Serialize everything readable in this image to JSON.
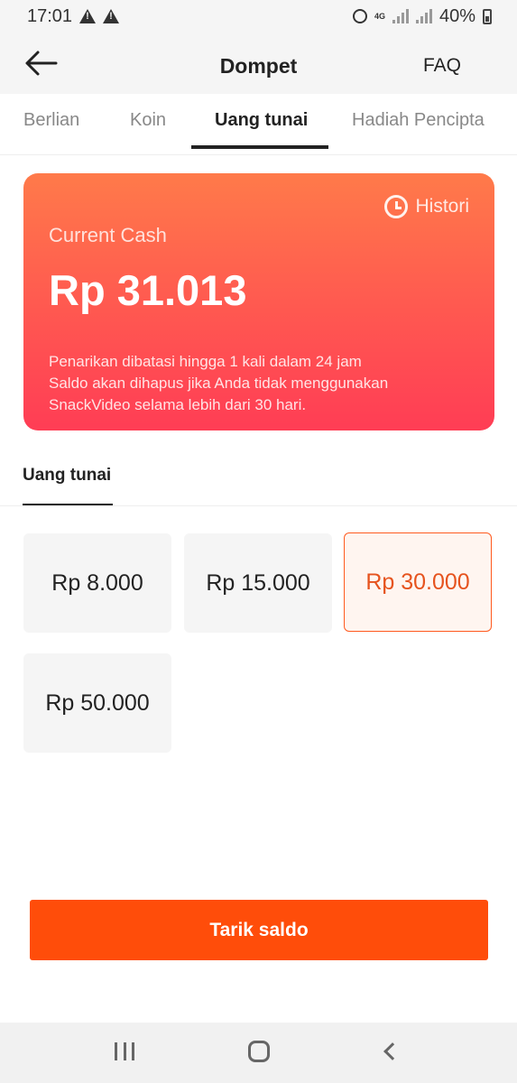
{
  "status_bar": {
    "time": "17:01",
    "network_label": "4G",
    "battery": "40%"
  },
  "header": {
    "title": "Dompet",
    "faq_label": "FAQ"
  },
  "tabs": [
    {
      "label": "Berlian",
      "active": false
    },
    {
      "label": "Koin",
      "active": false
    },
    {
      "label": "Uang tunai",
      "active": true
    },
    {
      "label": "Hadiah Pencipta",
      "active": false
    }
  ],
  "cash_card": {
    "history_label": "Histori",
    "label": "Current Cash",
    "amount": "Rp 31.013",
    "notes": [
      "Penarikan dibatasi hingga 1 kali dalam 24 jam",
      "Saldo akan dihapus jika Anda tidak menggunakan",
      "SnackVideo selama lebih dari 30 hari."
    ]
  },
  "section": {
    "tab_label": "Uang tunai"
  },
  "amount_options": [
    {
      "label": "Rp 8.000",
      "selected": false
    },
    {
      "label": "Rp 15.000",
      "selected": false
    },
    {
      "label": "Rp 30.000",
      "selected": true
    },
    {
      "label": "Rp 50.000",
      "selected": false
    }
  ],
  "withdraw_button": {
    "label": "Tarik saldo"
  },
  "colors": {
    "accent": "#ff4d0a",
    "selected_text": "#e6531e",
    "card_gradient_top": "#ff7a4a",
    "card_gradient_bottom": "#ff3d55"
  }
}
